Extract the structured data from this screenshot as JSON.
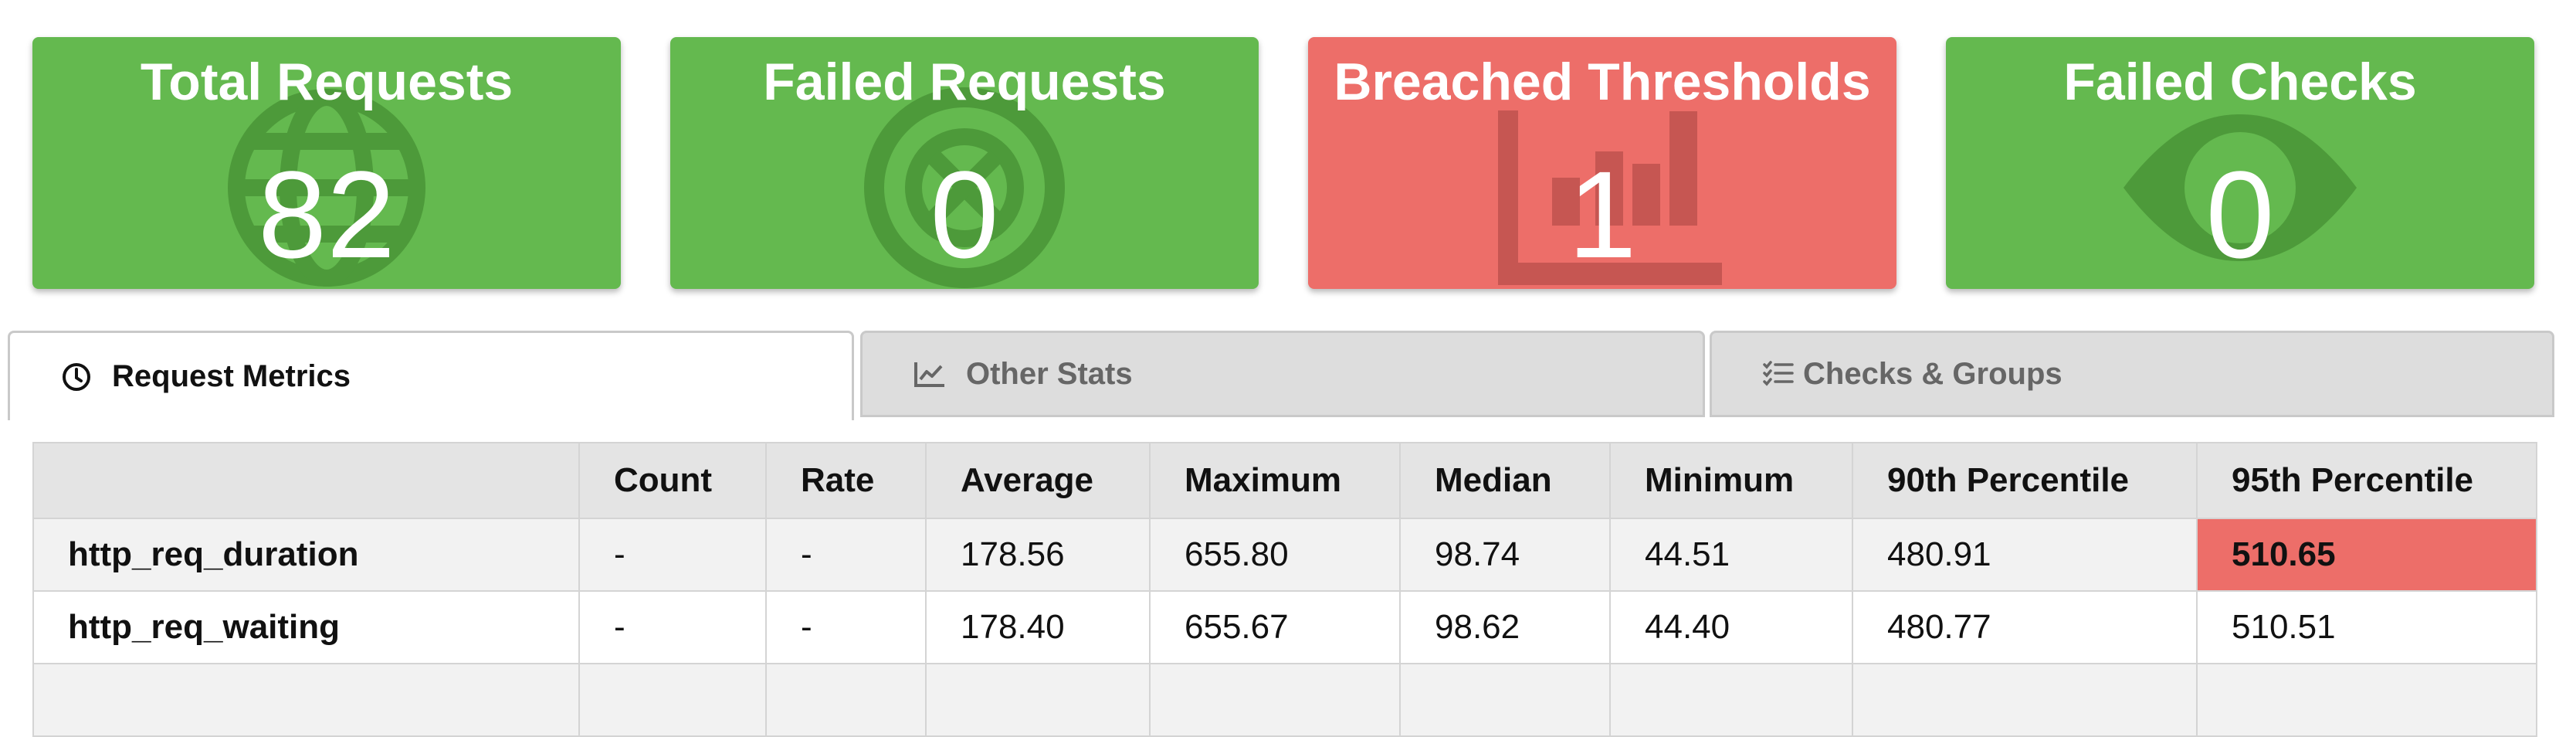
{
  "cards": [
    {
      "title": "Total Requests",
      "value": "82",
      "status": "ok",
      "icon": "globe-icon"
    },
    {
      "title": "Failed Requests",
      "value": "0",
      "status": "ok",
      "icon": "circle-x-icon"
    },
    {
      "title": "Breached Thresholds",
      "value": "1",
      "status": "breached",
      "icon": "bar-chart-icon"
    },
    {
      "title": "Failed Checks",
      "value": "0",
      "status": "ok",
      "icon": "eye-icon"
    }
  ],
  "colors": {
    "ok": "#64b94f",
    "breached": "#ed6e69",
    "tab_inactive": "#dddddd"
  },
  "tabs": [
    {
      "label": "Request Metrics",
      "icon": "clock-icon",
      "active": true
    },
    {
      "label": "Other Stats",
      "icon": "line-chart-icon",
      "active": false
    },
    {
      "label": "Checks & Groups",
      "icon": "checklist-icon",
      "active": false
    }
  ],
  "table": {
    "headers": [
      "",
      "Count",
      "Rate",
      "Average",
      "Maximum",
      "Median",
      "Minimum",
      "90th Percentile",
      "95th Percentile"
    ],
    "rows": [
      {
        "name": "http_req_duration",
        "cells": [
          "-",
          "-",
          "178.56",
          "655.80",
          "98.74",
          "44.51",
          "480.91",
          "510.65"
        ],
        "breached_column": "95th Percentile"
      },
      {
        "name": "http_req_waiting",
        "cells": [
          "-",
          "-",
          "178.40",
          "655.67",
          "98.62",
          "44.40",
          "480.77",
          "510.51"
        ]
      }
    ]
  }
}
